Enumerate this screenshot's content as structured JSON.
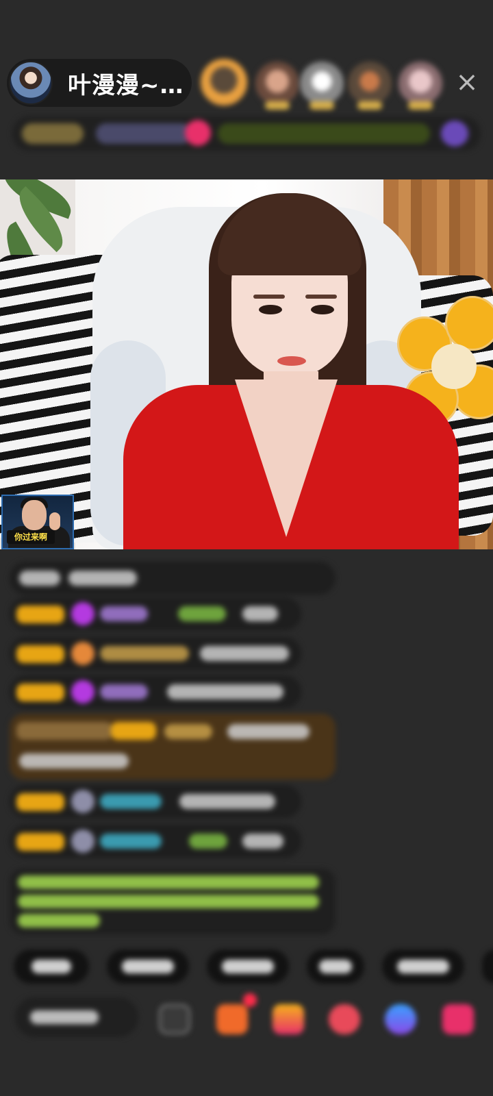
{
  "header": {
    "host_name": "叶漫漫~…",
    "close_label": "×"
  },
  "stream": {
    "pip_caption": "你过来啊"
  }
}
